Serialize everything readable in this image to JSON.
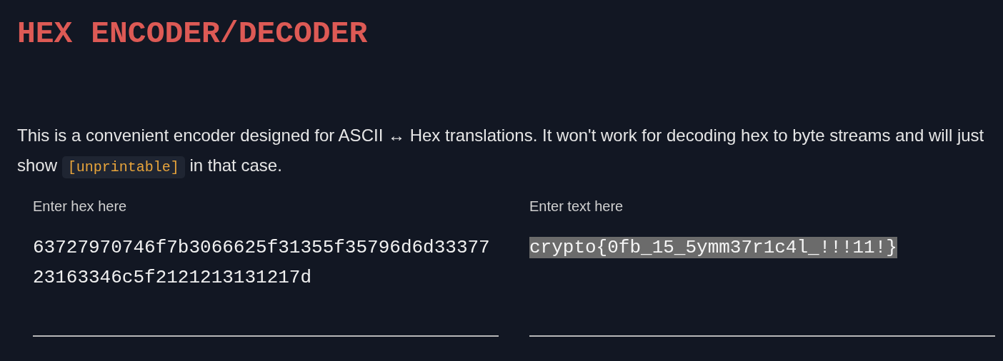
{
  "title": "HEX ENCODER/DECODER",
  "description": {
    "before": "This is a convenient encoder designed for ASCII ↔ Hex translations. It won't work for decoding hex to byte streams and will just show",
    "code": "[unprintable]",
    "after": "in that case."
  },
  "fields": [
    {
      "label": "Enter hex here",
      "value": "63727970746f7b3066625f31355f35796d6d3337723163346c5f2121213131217d",
      "selected": false
    },
    {
      "label": "Enter text here",
      "value": "crypto{0fb_15_5ymm37r1c4l_!!!11!}",
      "selected": true
    }
  ]
}
